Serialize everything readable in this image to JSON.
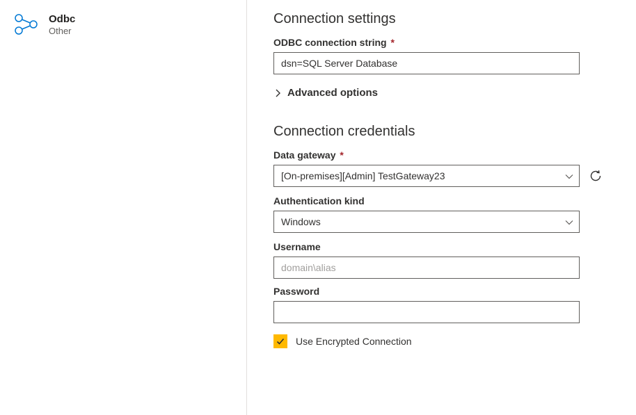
{
  "sidebar": {
    "title": "Odbc",
    "subtitle": "Other"
  },
  "settings": {
    "heading": "Connection settings",
    "conn_string": {
      "label": "ODBC connection string",
      "required": "*",
      "value": "dsn=SQL Server Database"
    },
    "advanced_label": "Advanced options"
  },
  "credentials": {
    "heading": "Connection credentials",
    "gateway": {
      "label": "Data gateway",
      "required": "*",
      "value": "[On-premises][Admin] TestGateway23"
    },
    "auth": {
      "label": "Authentication kind",
      "value": "Windows"
    },
    "username": {
      "label": "Username",
      "placeholder": "domain\\alias",
      "value": ""
    },
    "password": {
      "label": "Password",
      "value": ""
    },
    "encrypted": {
      "label": "Use Encrypted Connection",
      "checked": true
    }
  }
}
